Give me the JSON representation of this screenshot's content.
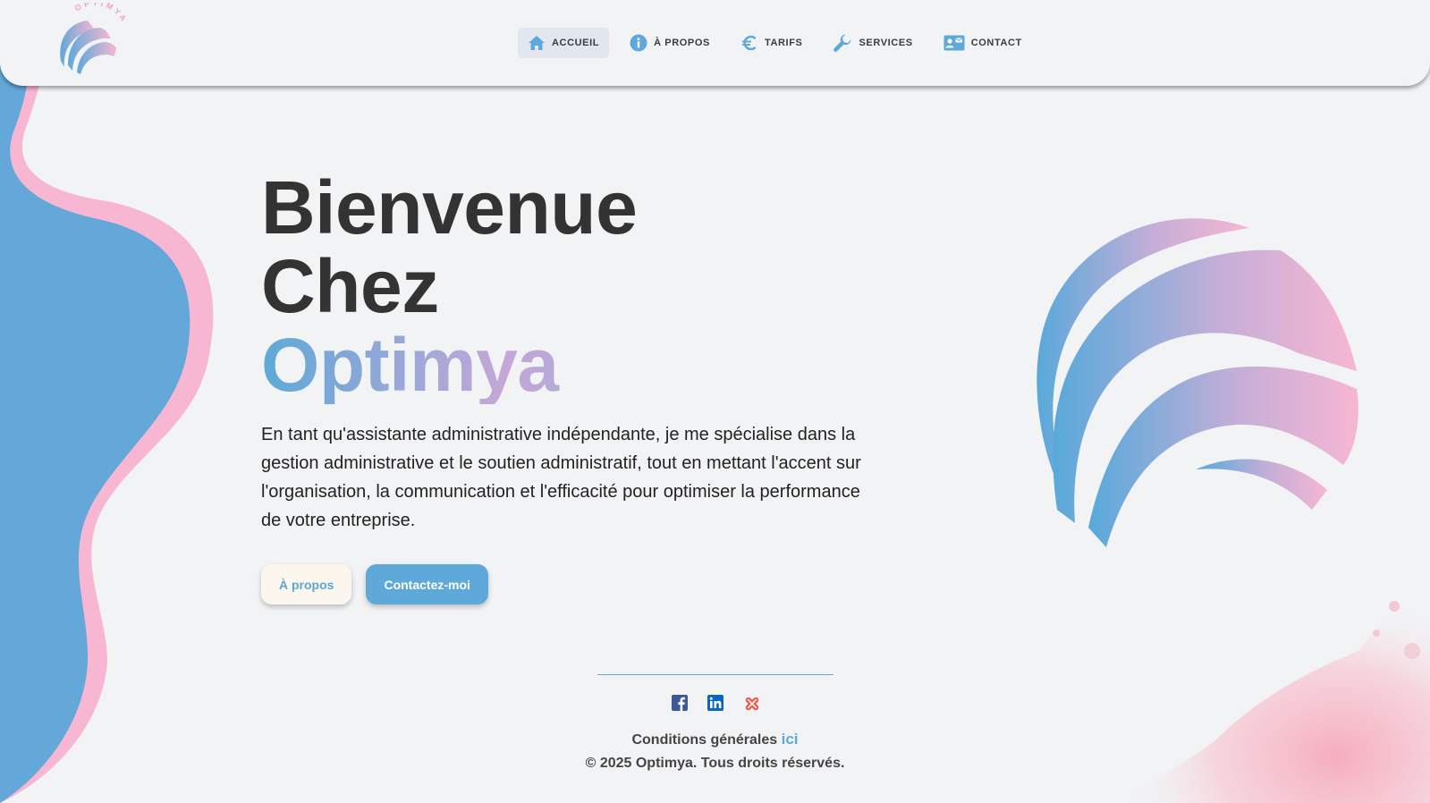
{
  "logo": {
    "text": "OPTIMYA"
  },
  "nav": {
    "items": [
      {
        "label": "ACCUEIL",
        "icon": "home-icon",
        "active": true
      },
      {
        "label": "À PROPOS",
        "icon": "info-icon",
        "active": false
      },
      {
        "label": "TARIFS",
        "icon": "euro-icon",
        "active": false
      },
      {
        "label": "SERVICES",
        "icon": "wrench-icon",
        "active": false
      },
      {
        "label": "CONTACT",
        "icon": "contact-card-icon",
        "active": false
      }
    ]
  },
  "hero": {
    "line1": "Bienvenue",
    "line2": "Chez",
    "brand": "Optimya",
    "description": "En tant qu'assistante administrative indépendante, je me spécialise dans la gestion administrative et le soutien administratif, tout en mettant l'accent sur l'organisation, la communication et l'efficacité pour optimiser la performance de votre entreprise.",
    "btn_about": "À propos",
    "btn_contact": "Contactez-moi"
  },
  "footer": {
    "socials": [
      "facebook-icon",
      "linkedin-icon",
      "malt-icon"
    ],
    "conditions_text": "Conditions générales",
    "conditions_link": "ici",
    "copyright": "© 2025 Optimya. Tous droits réservés."
  },
  "colors": {
    "blue": "#5ea9d9",
    "pink": "#f7b6d2",
    "background": "#f2f3f5",
    "text": "#333333"
  }
}
